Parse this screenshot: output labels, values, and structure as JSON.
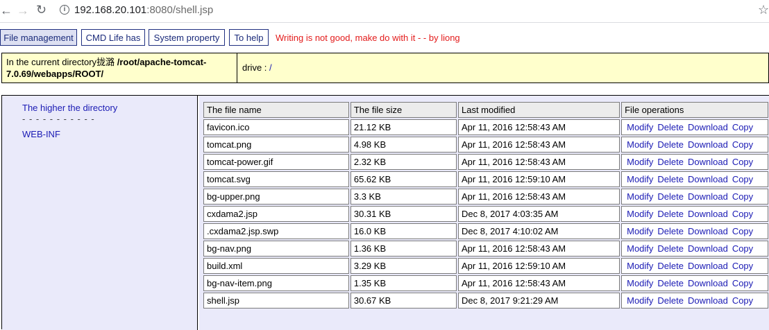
{
  "browser": {
    "url_host": "192.168.20.101",
    "url_rest": ":8080/shell.jsp"
  },
  "menu": {
    "items": [
      {
        "label": "File management"
      },
      {
        "label": "CMD Life has"
      },
      {
        "label": "System property"
      },
      {
        "label": "To help"
      }
    ],
    "note": "Writing is not good, make do with it - - by liong"
  },
  "pathbar": {
    "prefix": "In the current directory",
    "garbled": "拢潞",
    "path": "/root/apache-tomcat-7.0.69/webapps/ROOT/",
    "drive_label": "drive :",
    "drive_value": "/"
  },
  "sidebar": {
    "up_link": "The higher the directory",
    "divider": "- - - - - - - - - - -",
    "dirs": [
      "WEB-INF"
    ]
  },
  "table": {
    "headers": [
      "The file name",
      "The file size",
      "Last modified",
      "File operations"
    ],
    "operations": [
      "Modify",
      "Delete",
      "Download",
      "Copy"
    ],
    "rows": [
      {
        "name": "favicon.ico",
        "size": "21.12 KB",
        "modified": "Apr 11, 2016 12:58:43 AM"
      },
      {
        "name": "tomcat.png",
        "size": "4.98 KB",
        "modified": "Apr 11, 2016 12:58:43 AM"
      },
      {
        "name": "tomcat-power.gif",
        "size": "2.32 KB",
        "modified": "Apr 11, 2016 12:58:43 AM"
      },
      {
        "name": "tomcat.svg",
        "size": "65.62 KB",
        "modified": "Apr 11, 2016 12:59:10 AM"
      },
      {
        "name": "bg-upper.png",
        "size": "3.3 KB",
        "modified": "Apr 11, 2016 12:58:43 AM"
      },
      {
        "name": "cxdama2.jsp",
        "size": "30.31 KB",
        "modified": "Dec 8, 2017 4:03:35 AM"
      },
      {
        "name": ".cxdama2.jsp.swp",
        "size": "16.0 KB",
        "modified": "Dec 8, 2017 4:10:02 AM"
      },
      {
        "name": "bg-nav.png",
        "size": "1.36 KB",
        "modified": "Apr 11, 2016 12:58:43 AM"
      },
      {
        "name": "build.xml",
        "size": "3.29 KB",
        "modified": "Apr 11, 2016 12:59:10 AM"
      },
      {
        "name": "bg-nav-item.png",
        "size": "1.35 KB",
        "modified": "Apr 11, 2016 12:58:43 AM"
      },
      {
        "name": "shell.jsp",
        "size": "30.67 KB",
        "modified": "Dec 8, 2017 9:21:29 AM"
      }
    ]
  }
}
